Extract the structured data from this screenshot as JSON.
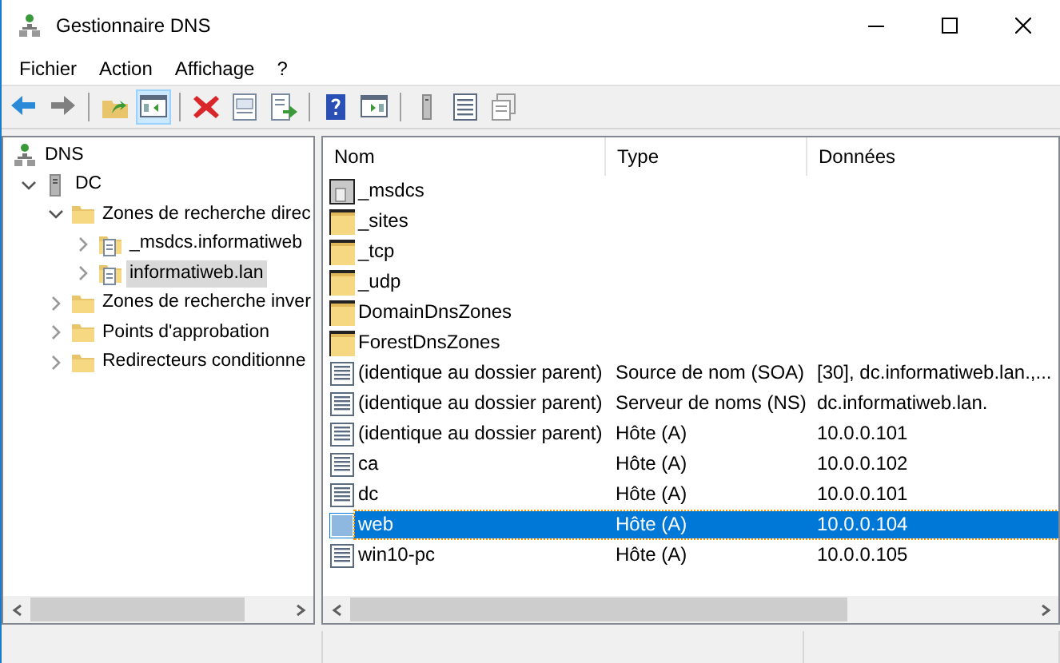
{
  "window": {
    "title": "Gestionnaire DNS"
  },
  "menu": [
    "Fichier",
    "Action",
    "Affichage",
    "?"
  ],
  "toolbar": [
    {
      "kind": "back",
      "pressed": false
    },
    {
      "kind": "forward",
      "pressed": false
    },
    {
      "kind": "sep"
    },
    {
      "kind": "up",
      "pressed": false
    },
    {
      "kind": "tree",
      "pressed": true
    },
    {
      "kind": "sep"
    },
    {
      "kind": "delete",
      "pressed": false
    },
    {
      "kind": "properties",
      "pressed": false
    },
    {
      "kind": "export",
      "pressed": false
    },
    {
      "kind": "sep"
    },
    {
      "kind": "help",
      "pressed": false
    },
    {
      "kind": "panel",
      "pressed": false
    },
    {
      "kind": "sep"
    },
    {
      "kind": "server",
      "pressed": false
    },
    {
      "kind": "list",
      "pressed": false
    },
    {
      "kind": "copy",
      "pressed": false
    }
  ],
  "tree": [
    {
      "label": "DNS",
      "kind": "dns",
      "selected": false,
      "children": [
        {
          "label": "DC",
          "kind": "server",
          "expanded": true,
          "selected": false,
          "children": [
            {
              "label": "Zones de recherche direc",
              "kind": "folder",
              "expanded": true,
              "selected": false,
              "children": [
                {
                  "label": "_msdcs.informatiweb",
                  "kind": "zone",
                  "expanded": false,
                  "selected": false
                },
                {
                  "label": "informatiweb.lan",
                  "kind": "zone",
                  "expanded": false,
                  "selected": true
                }
              ]
            },
            {
              "label": "Zones de recherche inver",
              "kind": "folder",
              "expanded": false,
              "selected": false
            },
            {
              "label": "Points d'approbation",
              "kind": "folder",
              "expanded": false,
              "selected": false
            },
            {
              "label": "Redirecteurs conditionne",
              "kind": "folder",
              "expanded": false,
              "selected": false
            }
          ]
        }
      ]
    }
  ],
  "table": {
    "columns": [
      "Nom",
      "Type",
      "Données"
    ],
    "rows": [
      {
        "kind": "zone",
        "name": "_msdcs",
        "type": "",
        "data": "",
        "selected": false
      },
      {
        "kind": "folder",
        "name": "_sites",
        "type": "",
        "data": "",
        "selected": false
      },
      {
        "kind": "folder",
        "name": "_tcp",
        "type": "",
        "data": "",
        "selected": false
      },
      {
        "kind": "folder",
        "name": "_udp",
        "type": "",
        "data": "",
        "selected": false
      },
      {
        "kind": "folder",
        "name": "DomainDnsZones",
        "type": "",
        "data": "",
        "selected": false
      },
      {
        "kind": "folder",
        "name": "ForestDnsZones",
        "type": "",
        "data": "",
        "selected": false
      },
      {
        "kind": "record",
        "name": "(identique au dossier parent)",
        "type": "Source de nom (SOA)",
        "data": "[30], dc.informatiweb.lan.,...",
        "selected": false
      },
      {
        "kind": "record",
        "name": "(identique au dossier parent)",
        "type": "Serveur de noms (NS)",
        "data": "dc.informatiweb.lan.",
        "selected": false
      },
      {
        "kind": "record",
        "name": "(identique au dossier parent)",
        "type": "Hôte (A)",
        "data": "10.0.0.101",
        "selected": false
      },
      {
        "kind": "record",
        "name": "ca",
        "type": "Hôte (A)",
        "data": "10.0.0.102",
        "selected": false
      },
      {
        "kind": "record",
        "name": "dc",
        "type": "Hôte (A)",
        "data": "10.0.0.101",
        "selected": false
      },
      {
        "kind": "record",
        "name": "web",
        "type": "Hôte (A)",
        "data": "10.0.0.104",
        "selected": true
      },
      {
        "kind": "record",
        "name": "win10-pc",
        "type": "Hôte (A)",
        "data": "10.0.0.105",
        "selected": false
      }
    ]
  }
}
